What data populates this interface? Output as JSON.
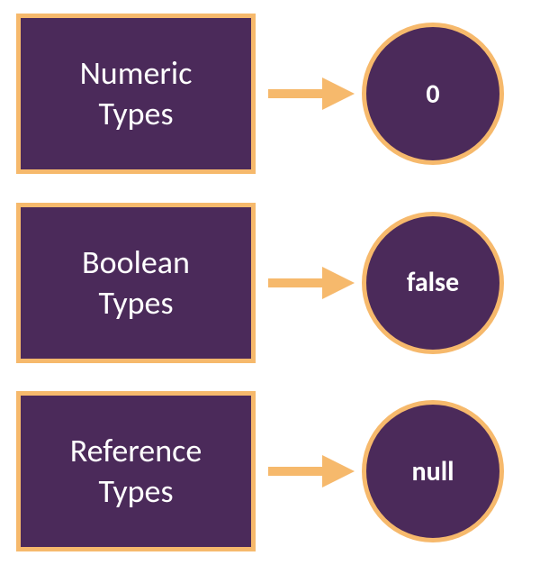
{
  "colors": {
    "fill": "#4b2a5a",
    "accent": "#f6b96c",
    "arrow": "#f6b96c",
    "text": "#ffffff"
  },
  "rows": [
    {
      "box_label": "Numeric\nTypes",
      "circle_label": "0"
    },
    {
      "box_label": "Boolean\nTypes",
      "circle_label": "false"
    },
    {
      "box_label": "Reference\nTypes",
      "circle_label": "null"
    }
  ],
  "icons": {
    "arrow_right": "arrow-right-icon"
  }
}
